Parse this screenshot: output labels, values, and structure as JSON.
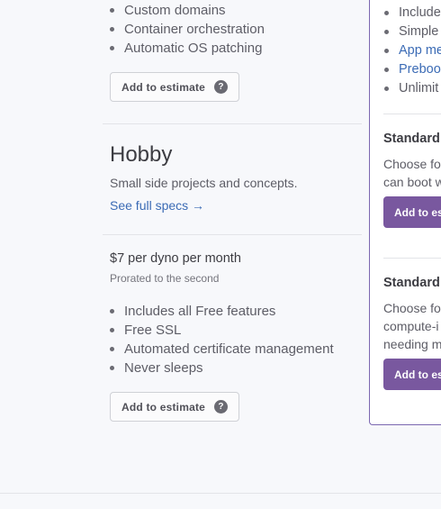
{
  "top_plan": {
    "features": [
      "Custom domains",
      "Container orchestration",
      "Automatic OS patching"
    ],
    "add_button": "Add to estimate",
    "help_glyph": "?"
  },
  "hobby": {
    "title": "Hobby",
    "description": "Small side projects and concepts.",
    "spec_link": "See full specs →",
    "price": "$7 per dyno per month",
    "price_note": "Prorated to the second",
    "features": [
      "Includes all Free features",
      "Free SSL",
      "Automated certificate management",
      "Never sleeps"
    ],
    "add_button": "Add to estimate",
    "help_glyph": "?"
  },
  "right_panel": {
    "features": [
      {
        "text": "Include",
        "link": false
      },
      {
        "text": "Simple",
        "link": false
      },
      {
        "text": "App me",
        "link": true
      },
      {
        "text": "Preboo",
        "link": true
      },
      {
        "text": "Unlimit",
        "link": false
      }
    ],
    "standard_1": {
      "title": "Standard",
      "desc_lines": [
        "Choose fo",
        "can boot w"
      ],
      "button": "Add to es"
    },
    "standard_2": {
      "title": "Standard",
      "desc_lines": [
        "Choose fo",
        "compute-i",
        "needing m"
      ],
      "button": "Add to es"
    }
  }
}
